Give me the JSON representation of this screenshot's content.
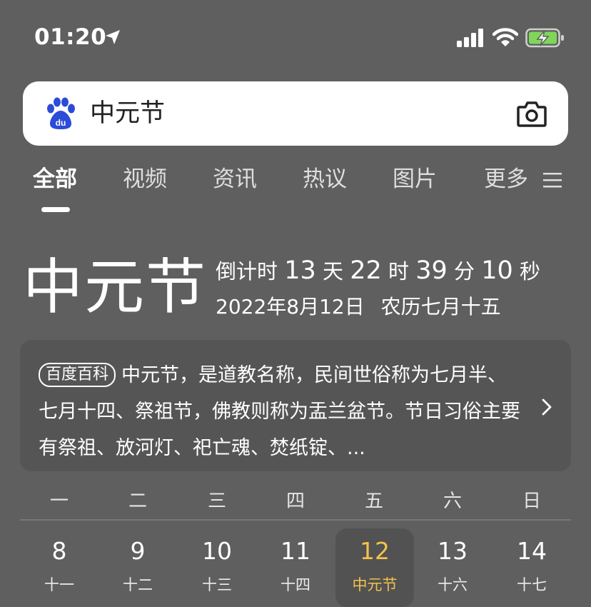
{
  "status_bar": {
    "time": "01:20"
  },
  "search": {
    "query": "中元节"
  },
  "tabs": [
    {
      "label": "全部",
      "active": true
    },
    {
      "label": "视频"
    },
    {
      "label": "资讯"
    },
    {
      "label": "热议"
    },
    {
      "label": "图片"
    },
    {
      "label": "更多"
    }
  ],
  "festival": {
    "title": "中元节",
    "countdown_label": "倒计时",
    "days": "13",
    "days_unit": "天",
    "hours": "22",
    "hours_unit": "时",
    "minutes": "39",
    "minutes_unit": "分",
    "seconds": "10",
    "seconds_unit": "秒",
    "date": "2022年8月12日",
    "lunar_date": "农历七月十五"
  },
  "baike": {
    "badge": "百度百科",
    "text": "中元节，是道教名称，民间世俗称为七月半、七月十四、祭祖节，佛教则称为盂兰盆节。节日习俗主要有祭祖、放河灯、祀亡魂、焚纸锭、..."
  },
  "calendar": {
    "weekdays": [
      "一",
      "二",
      "三",
      "四",
      "五",
      "六",
      "日"
    ],
    "days": [
      {
        "num": "8",
        "lunar": "十一"
      },
      {
        "num": "9",
        "lunar": "十二"
      },
      {
        "num": "10",
        "lunar": "十三"
      },
      {
        "num": "11",
        "lunar": "十四"
      },
      {
        "num": "12",
        "lunar": "中元节",
        "selected": true
      },
      {
        "num": "13",
        "lunar": "十六"
      },
      {
        "num": "14",
        "lunar": "十七"
      }
    ]
  },
  "colors": {
    "background": "#5f5f5f",
    "selected": "#f2c24a",
    "battery": "#7fd65a",
    "baidu_blue": "#2c4bd8"
  }
}
